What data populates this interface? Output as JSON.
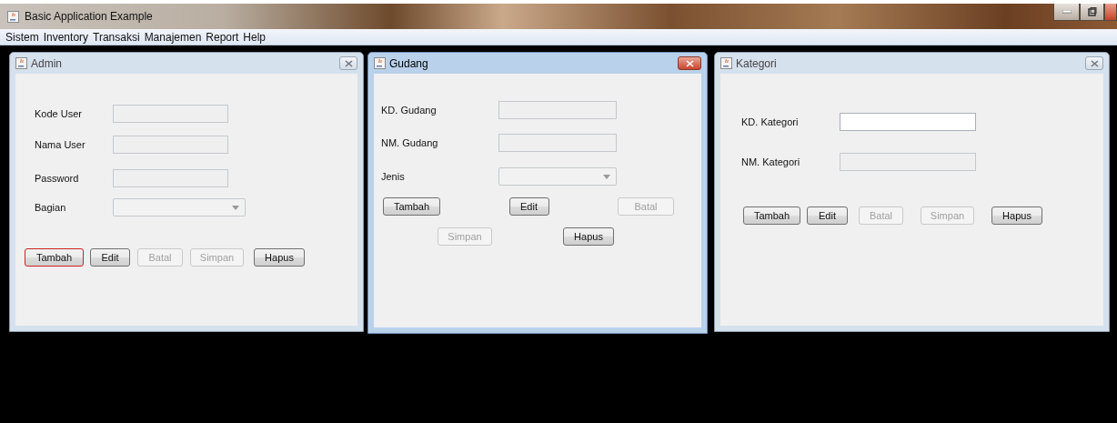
{
  "window": {
    "title": "Basic Application Example"
  },
  "menu": [
    "Sistem",
    "Inventory",
    "Transaksi",
    "Manajemen",
    "Report",
    "Help"
  ],
  "frames": [
    {
      "title": "Admin",
      "active": false,
      "fields": [
        {
          "label": "Kode User",
          "kind": "text",
          "editable": false
        },
        {
          "label": "Nama User",
          "kind": "text",
          "editable": false
        },
        {
          "label": "Password",
          "kind": "text",
          "editable": false
        },
        {
          "label": "Bagian",
          "kind": "combo",
          "editable": false
        }
      ],
      "button_rows": [
        [
          {
            "label": "Tambah",
            "disabled": false,
            "focused": true
          },
          {
            "label": "Edit",
            "disabled": false,
            "focused": false
          },
          {
            "label": "Batal",
            "disabled": true,
            "focused": false
          },
          {
            "label": "Simpan",
            "disabled": true,
            "focused": false
          },
          {
            "label": "Hapus",
            "disabled": false,
            "focused": false
          }
        ]
      ]
    },
    {
      "title": "Gudang",
      "active": true,
      "fields": [
        {
          "label": "KD. Gudang",
          "kind": "text",
          "editable": false
        },
        {
          "label": "NM. Gudang",
          "kind": "text",
          "editable": false
        },
        {
          "label": "Jenis",
          "kind": "combo",
          "editable": false
        }
      ],
      "button_rows": [
        [
          {
            "label": "Tambah",
            "disabled": false,
            "focused": false
          },
          {
            "label": "Edit",
            "disabled": false,
            "focused": false
          },
          {
            "label": "Batal",
            "disabled": true,
            "focused": false
          }
        ],
        [
          {
            "label": "Simpan",
            "disabled": true,
            "focused": false
          },
          {
            "label": "Hapus",
            "disabled": false,
            "focused": false
          }
        ]
      ]
    },
    {
      "title": "Kategori",
      "active": false,
      "fields": [
        {
          "label": "KD. Kategori",
          "kind": "text",
          "editable": true
        },
        {
          "label": "NM. Kategori",
          "kind": "text",
          "editable": false
        }
      ],
      "button_rows": [
        [
          {
            "label": "Tambah",
            "disabled": false,
            "focused": false
          },
          {
            "label": "Edit",
            "disabled": false,
            "focused": false
          },
          {
            "label": "Batal",
            "disabled": true,
            "focused": false
          },
          {
            "label": "Simpan",
            "disabled": true,
            "focused": false
          },
          {
            "label": "Hapus",
            "disabled": false,
            "focused": false
          }
        ]
      ]
    }
  ]
}
